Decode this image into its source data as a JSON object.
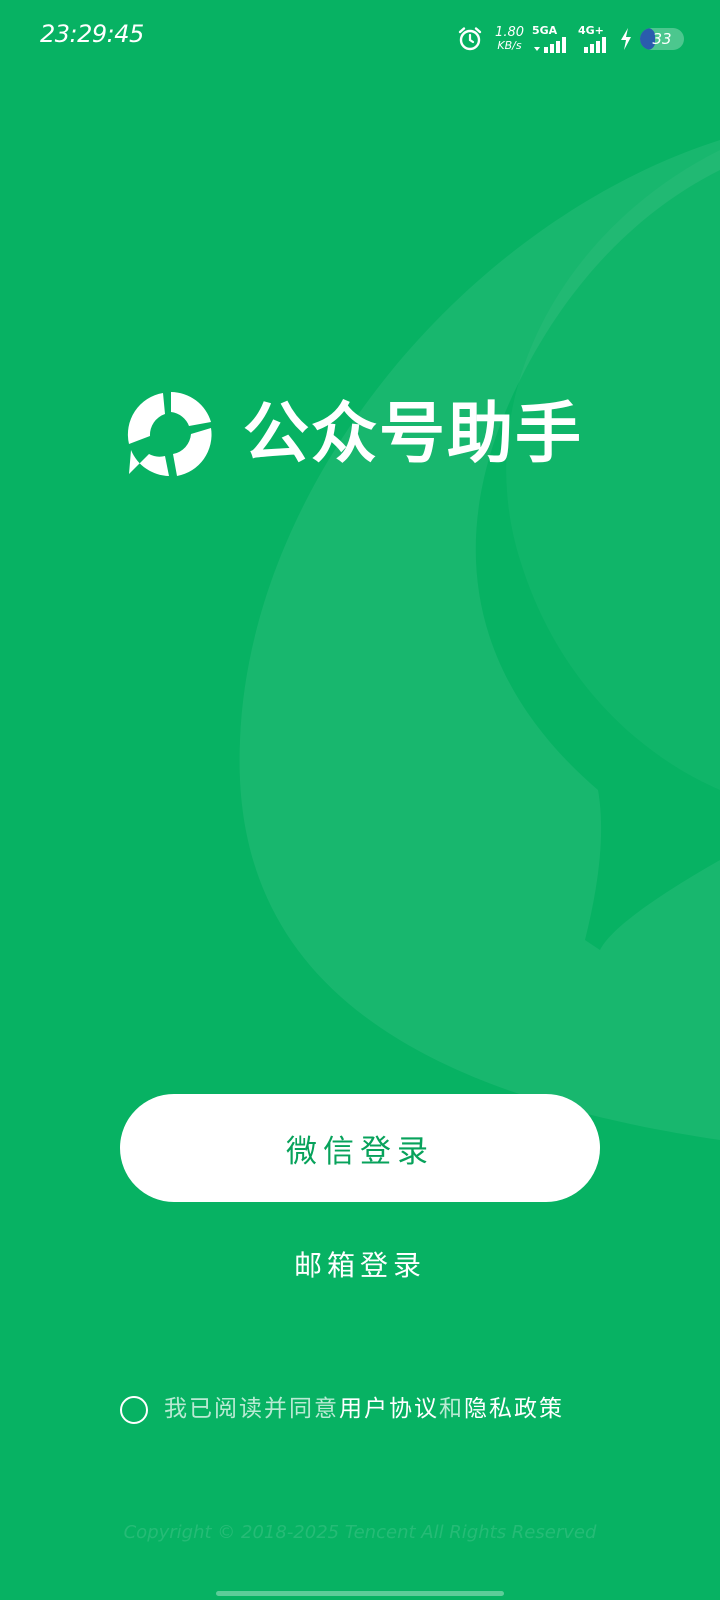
{
  "status_bar": {
    "time": "23:29:45",
    "net_speed_value": "1.80",
    "net_speed_unit": "KB/s",
    "sim1_label": "5GA",
    "sim2_label": "4G+",
    "battery_level": "33",
    "battery_fraction": 0.33
  },
  "app": {
    "name": "公众号助手"
  },
  "login": {
    "wechat_label": "微信登录",
    "email_label": "邮箱登录"
  },
  "agreement": {
    "prefix": "我已阅读并同意",
    "user_agreement": "用户协议",
    "conjunction": "和",
    "privacy_policy": "隐私政策"
  },
  "footer": {
    "copyright": "Copyright © 2018-2025 Tencent All Rights Reserved"
  },
  "colors": {
    "background": "#07b263",
    "button_text": "#07a25b",
    "battery_fill": "#2a5cad"
  }
}
